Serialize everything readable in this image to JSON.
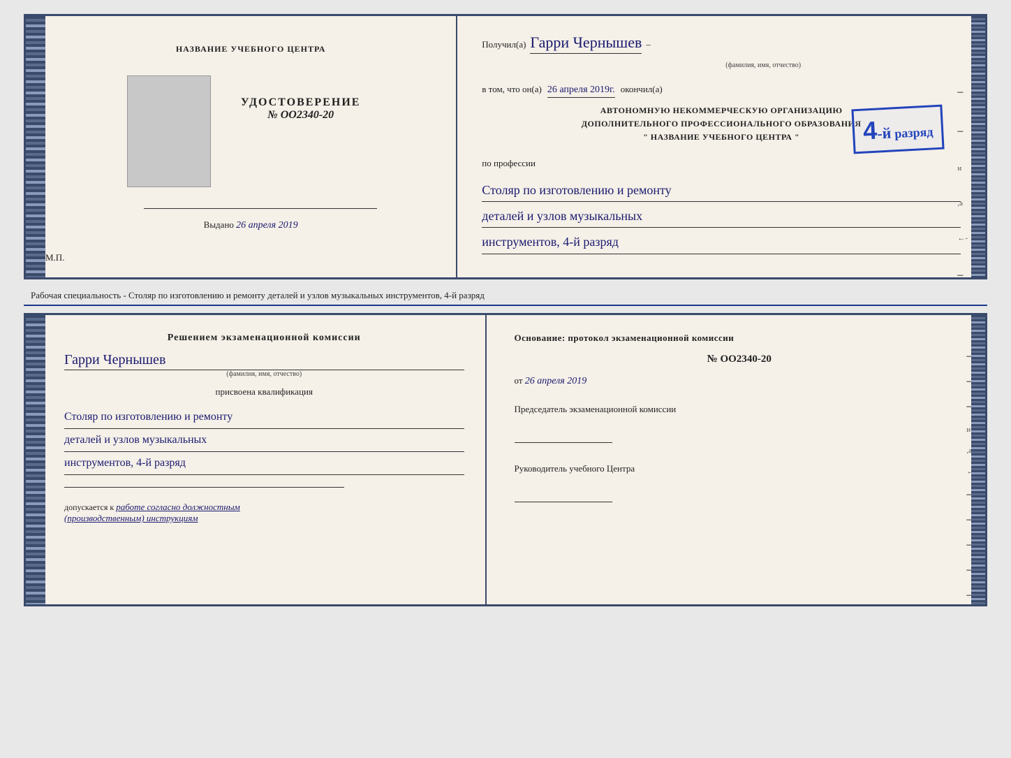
{
  "page": {
    "background": "#e8e8e8"
  },
  "top_document": {
    "left": {
      "org_name_label": "НАЗВАНИЕ УЧЕБНОГО ЦЕНТРА",
      "cert_title": "УДОСТОВЕРЕНИЕ",
      "cert_number": "№ OO2340-20",
      "issued_label": "Выдано",
      "issued_date": "26 апреля 2019",
      "mp_label": "М.П."
    },
    "right": {
      "received_prefix": "Получил(а)",
      "recipient_name": "Гарри Чернышев",
      "fio_hint": "(фамилия, имя, отчество)",
      "dash": "–",
      "in_that_prefix": "в том, что он(а)",
      "date": "26 апреля 2019г.",
      "finished_label": "окончил(а)",
      "org_type_line1": "АВТОНОМНУЮ НЕКОММЕРЧЕСКУЮ ОРГАНИЗАЦИЮ",
      "org_type_line2": "ДОПОЛНИТЕЛЬНОГО ПРОФЕССИОНАЛЬНОГО ОБРАЗОВАНИЯ",
      "org_name_quoted": "\" НАЗВАНИЕ УЧЕБНОГО ЦЕНТРА \"",
      "profession_label": "по профессии",
      "profession_line1": "Столяр по изготовлению и ремонту",
      "profession_line2": "деталей и узлов музыкальных",
      "profession_line3": "инструментов, 4-й разряд",
      "stamp": {
        "rank_number": "4",
        "rank_suffix": "-й",
        "rank_label": "разряд"
      }
    }
  },
  "separator": {
    "text": "Рабочая специальность - Столяр по изготовлению и ремонту деталей и узлов музыкальных инструментов, 4-й разряд"
  },
  "bottom_document": {
    "left": {
      "decision_title": "Решением  экзаменационной  комиссии",
      "recipient_name": "Гарри Чернышев",
      "fio_hint": "(фамилия, имя, отчество)",
      "assigned_label": "присвоена квалификация",
      "qual_line1": "Столяр по изготовлению и ремонту",
      "qual_line2": "деталей и узлов музыкальных",
      "qual_line3": "инструментов, 4-й разряд",
      "allowed_prefix": "допускается к",
      "allowed_text": "работе согласно должностным",
      "allowed_text2": "(производственным) инструкциям"
    },
    "right": {
      "basis_label": "Основание: протокол экзаменационной  комиссии",
      "protocol_number": "№  OO2340-20",
      "date_prefix": "от",
      "date": "26 апреля 2019",
      "chairman_title": "Председатель экзаменационной комиссии",
      "director_title": "Руководитель учебного Центра",
      "dashes": [
        "-",
        "-",
        "-",
        "и",
        ",а",
        "←-",
        "-",
        "-",
        "-",
        "-",
        "-"
      ]
    }
  }
}
